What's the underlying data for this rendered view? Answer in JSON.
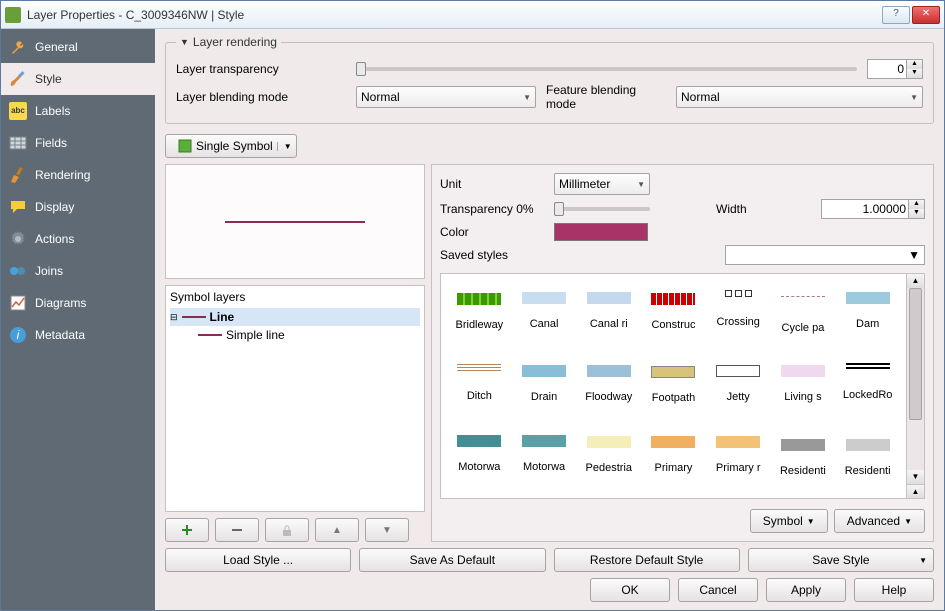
{
  "window": {
    "title": "Layer Properties - C_3009346NW | Style"
  },
  "sidebar": {
    "items": [
      {
        "label": "General"
      },
      {
        "label": "Style"
      },
      {
        "label": "Labels"
      },
      {
        "label": "Fields"
      },
      {
        "label": "Rendering"
      },
      {
        "label": "Display"
      },
      {
        "label": "Actions"
      },
      {
        "label": "Joins"
      },
      {
        "label": "Diagrams"
      },
      {
        "label": "Metadata"
      }
    ],
    "active": 1
  },
  "render": {
    "group_label": "Layer rendering",
    "transparency_label": "Layer transparency",
    "transparency_value": "0",
    "blend_label": "Layer blending mode",
    "blend_value": "Normal",
    "feature_blend_label": "Feature blending mode",
    "feature_blend_value": "Normal"
  },
  "symbol_selector": {
    "label": "Single Symbol"
  },
  "symbol_layers": {
    "header": "Symbol layers",
    "root": "Line",
    "child": "Simple line"
  },
  "props": {
    "unit_label": "Unit",
    "unit_value": "Millimeter",
    "transp_label": "Transparency 0%",
    "width_label": "Width",
    "width_value": "1.00000",
    "color_label": "Color",
    "saved_label": "Saved styles",
    "color_hex": "#a83367"
  },
  "gallery": [
    {
      "label": "Bridleway",
      "cls": "sw-bridle"
    },
    {
      "label": "Canal",
      "cls": "sw-canal"
    },
    {
      "label": "Canal ri",
      "cls": "sw-canal2"
    },
    {
      "label": "Construc",
      "cls": "sw-constr"
    },
    {
      "label": "Crossing",
      "cls": "sw-cross"
    },
    {
      "label": "Cycle pa",
      "cls": "sw-cycle"
    },
    {
      "label": "Dam",
      "cls": "sw-dam"
    },
    {
      "label": "Ditch",
      "cls": "sw-ditch"
    },
    {
      "label": "Drain",
      "cls": "sw-drain"
    },
    {
      "label": "Floodway",
      "cls": "sw-flood"
    },
    {
      "label": "Footpath",
      "cls": "sw-foot"
    },
    {
      "label": "Jetty",
      "cls": "sw-jetty"
    },
    {
      "label": "Living s",
      "cls": "sw-living"
    },
    {
      "label": "LockedRo",
      "cls": "sw-locked"
    },
    {
      "label": "Motorwa",
      "cls": "sw-mw1"
    },
    {
      "label": "Motorwa",
      "cls": "sw-mw2"
    },
    {
      "label": "Pedestria",
      "cls": "sw-ped"
    },
    {
      "label": "Primary",
      "cls": "sw-prim"
    },
    {
      "label": "Primary r",
      "cls": "sw-prim2"
    },
    {
      "label": "Residenti",
      "cls": "sw-res1"
    },
    {
      "label": "Residenti",
      "cls": "sw-res2"
    }
  ],
  "buttons": {
    "symbol": "Symbol",
    "advanced": "Advanced",
    "load": "Load Style ...",
    "save_default": "Save As Default",
    "restore": "Restore Default Style",
    "save_style": "Save Style",
    "ok": "OK",
    "cancel": "Cancel",
    "apply": "Apply",
    "help": "Help"
  }
}
